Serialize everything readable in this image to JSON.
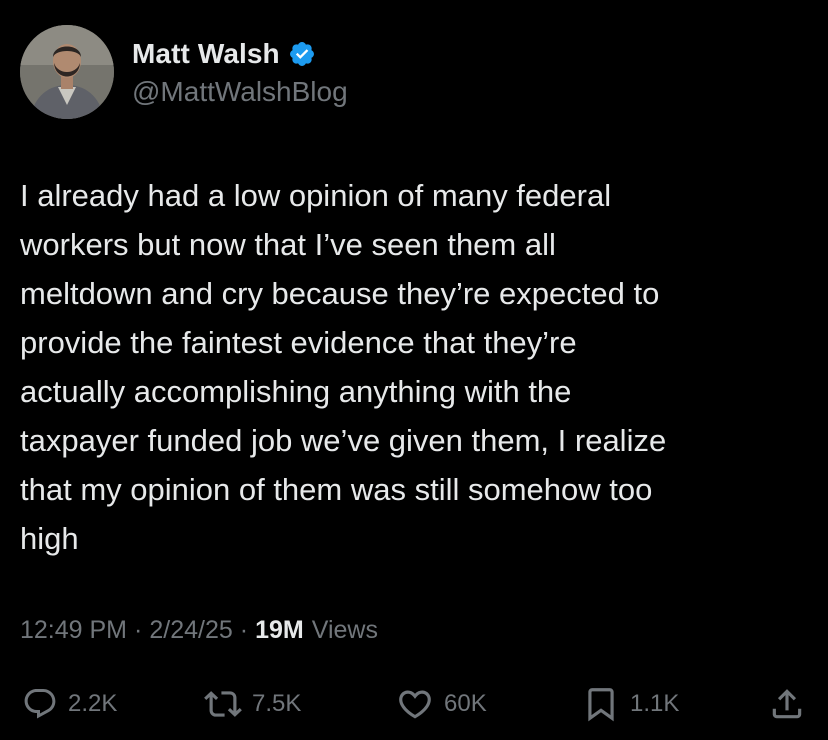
{
  "author": {
    "display_name": "Matt Walsh",
    "handle": "@MattWalshBlog",
    "verified": true,
    "verified_color": "#1d9bf0"
  },
  "tweet": {
    "text": "I already had a low opinion of many federal\nworkers but now that I’ve seen them all\nmeltdown and cry because they’re expected to\nprovide the faintest evidence that they’re\nactually accomplishing anything with the\ntaxpayer funded job we’ve given them, I realize\nthat my opinion of them was still somehow too\nhigh"
  },
  "meta": {
    "time": "12:49 PM",
    "separator": "·",
    "date": "2/24/25",
    "views_count": "19M",
    "views_label": "Views"
  },
  "actions": {
    "replies": {
      "icon": "reply-icon",
      "count": "2.2K"
    },
    "reposts": {
      "icon": "repost-icon",
      "count": "7.5K"
    },
    "likes": {
      "icon": "heart-icon",
      "count": "60K"
    },
    "bookmarks": {
      "icon": "bookmark-icon",
      "count": "1.1K"
    },
    "share": {
      "icon": "share-icon"
    }
  },
  "colors": {
    "background": "#000000",
    "primary_text": "#e7e9ea",
    "secondary_text": "#71767b"
  }
}
